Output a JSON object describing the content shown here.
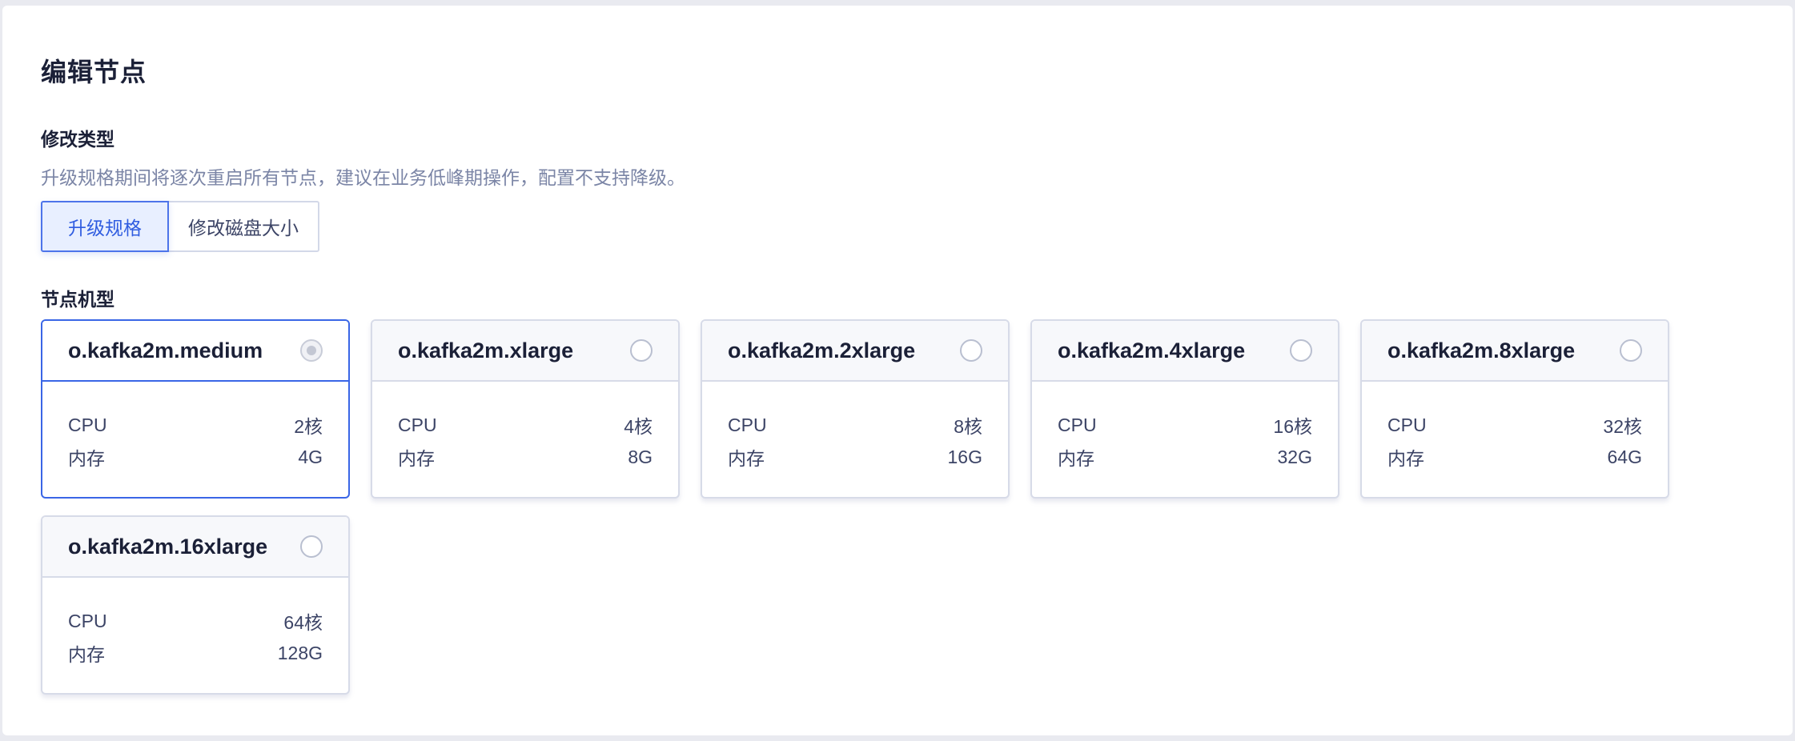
{
  "title": "编辑节点",
  "modify_type": {
    "label": "修改类型",
    "hint": "升级规格期间将逐次重启所有节点，建议在业务低峰期操作，配置不支持降级。",
    "options": [
      {
        "label": "升级规格",
        "active": true
      },
      {
        "label": "修改磁盘大小",
        "active": false
      }
    ]
  },
  "node_type": {
    "label": "节点机型",
    "cpu_label": "CPU",
    "mem_label": "内存",
    "cards": [
      {
        "name": "o.kafka2m.medium",
        "cpu": "2核",
        "memory": "4G",
        "selected": true
      },
      {
        "name": "o.kafka2m.xlarge",
        "cpu": "4核",
        "memory": "8G",
        "selected": false
      },
      {
        "name": "o.kafka2m.2xlarge",
        "cpu": "8核",
        "memory": "16G",
        "selected": false
      },
      {
        "name": "o.kafka2m.4xlarge",
        "cpu": "16核",
        "memory": "32G",
        "selected": false
      },
      {
        "name": "o.kafka2m.8xlarge",
        "cpu": "32核",
        "memory": "64G",
        "selected": false
      },
      {
        "name": "o.kafka2m.16xlarge",
        "cpu": "64核",
        "memory": "128G",
        "selected": false
      }
    ]
  }
}
